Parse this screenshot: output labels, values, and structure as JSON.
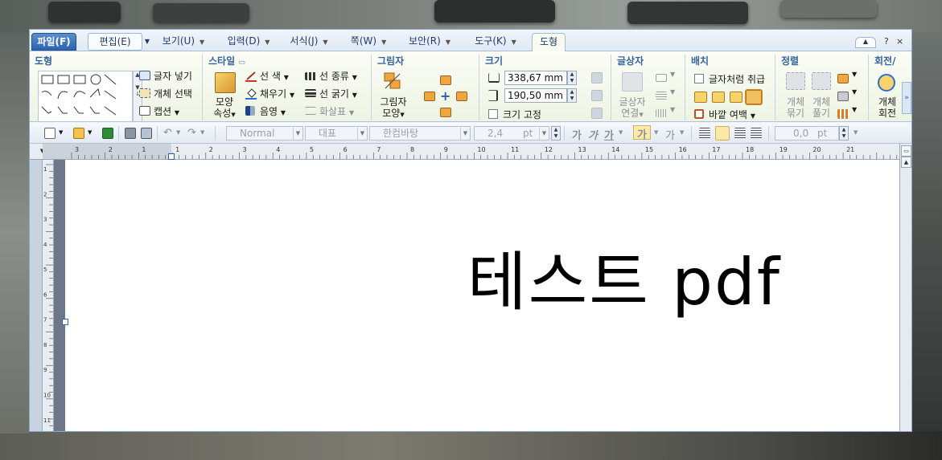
{
  "menu": {
    "tabs": [
      {
        "label": "파일(F)"
      },
      {
        "label": "편집(E)"
      },
      {
        "label": "보기(U)"
      },
      {
        "label": "입력(D)"
      },
      {
        "label": "서식(J)"
      },
      {
        "label": "쪽(W)"
      },
      {
        "label": "보안(R)"
      },
      {
        "label": "도구(K)"
      },
      {
        "label": "도형"
      }
    ],
    "help": "?",
    "close": "×"
  },
  "ribbon": {
    "groups": {
      "shape": "도형",
      "style": "스타일",
      "picture": "그림자",
      "size": "크기",
      "textbox": "글상자",
      "arrange": "배치",
      "align": "정렬",
      "rotate": "회전/"
    },
    "shape_buttons": {
      "insert_text": "글자 넣기",
      "select_object": "개체 선택",
      "caption": "캡션"
    },
    "style_buttons": {
      "shape_props_line1": "모양",
      "shape_props_line2": "속성",
      "line_color": "선 색",
      "fill": "채우기",
      "shade": "음영",
      "line_type": "선 종류",
      "line_width": "선 굵기",
      "arrow": "화살표"
    },
    "shadow_buttons": {
      "shadow_shape_line1": "그림자",
      "shadow_shape_line2": "모양"
    },
    "size": {
      "width": "338,67",
      "height": "190,50",
      "unit": "mm",
      "fix_size": "크기 고정"
    },
    "textbox_buttons": {
      "link_line1": "글상자",
      "link_line2": "연결"
    },
    "arrange_buttons": {
      "treat_as_char": "글자처럼 취급",
      "outer_margin": "바깥 여백"
    },
    "align_buttons": {
      "group_line1": "개체",
      "group_line2": "묶기",
      "ungroup_line1": "개체",
      "ungroup_line2": "풀기"
    },
    "rotate_buttons": {
      "rotate_line1": "개체",
      "rotate_line2": "회전"
    }
  },
  "toolbar": {
    "style": "Normal",
    "outline": "대표",
    "font": "한컴바탕",
    "font_size": "2,4",
    "font_unit": "pt",
    "bold": "가",
    "italic": "가",
    "underline": "가",
    "char_color": "가",
    "char_shade": "가",
    "line_spacing": "0,0",
    "line_unit": "pt"
  },
  "ruler": {
    "marks": [
      "3",
      "2",
      "1",
      "1",
      "2",
      "3",
      "4",
      "5",
      "6",
      "7",
      "8",
      "9",
      "10",
      "11",
      "12",
      "13",
      "14",
      "15",
      "16",
      "17",
      "18",
      "19",
      "20",
      "21"
    ],
    "vmarks": [
      "1",
      "2",
      "3",
      "4",
      "5",
      "6",
      "7",
      "8",
      "9",
      "10",
      "11"
    ]
  },
  "document": {
    "text": "테스트 pdf"
  },
  "colors": {
    "accent": "#2a64b0",
    "ribbon_bg": "#eef4e3",
    "page": "#ffffff"
  }
}
